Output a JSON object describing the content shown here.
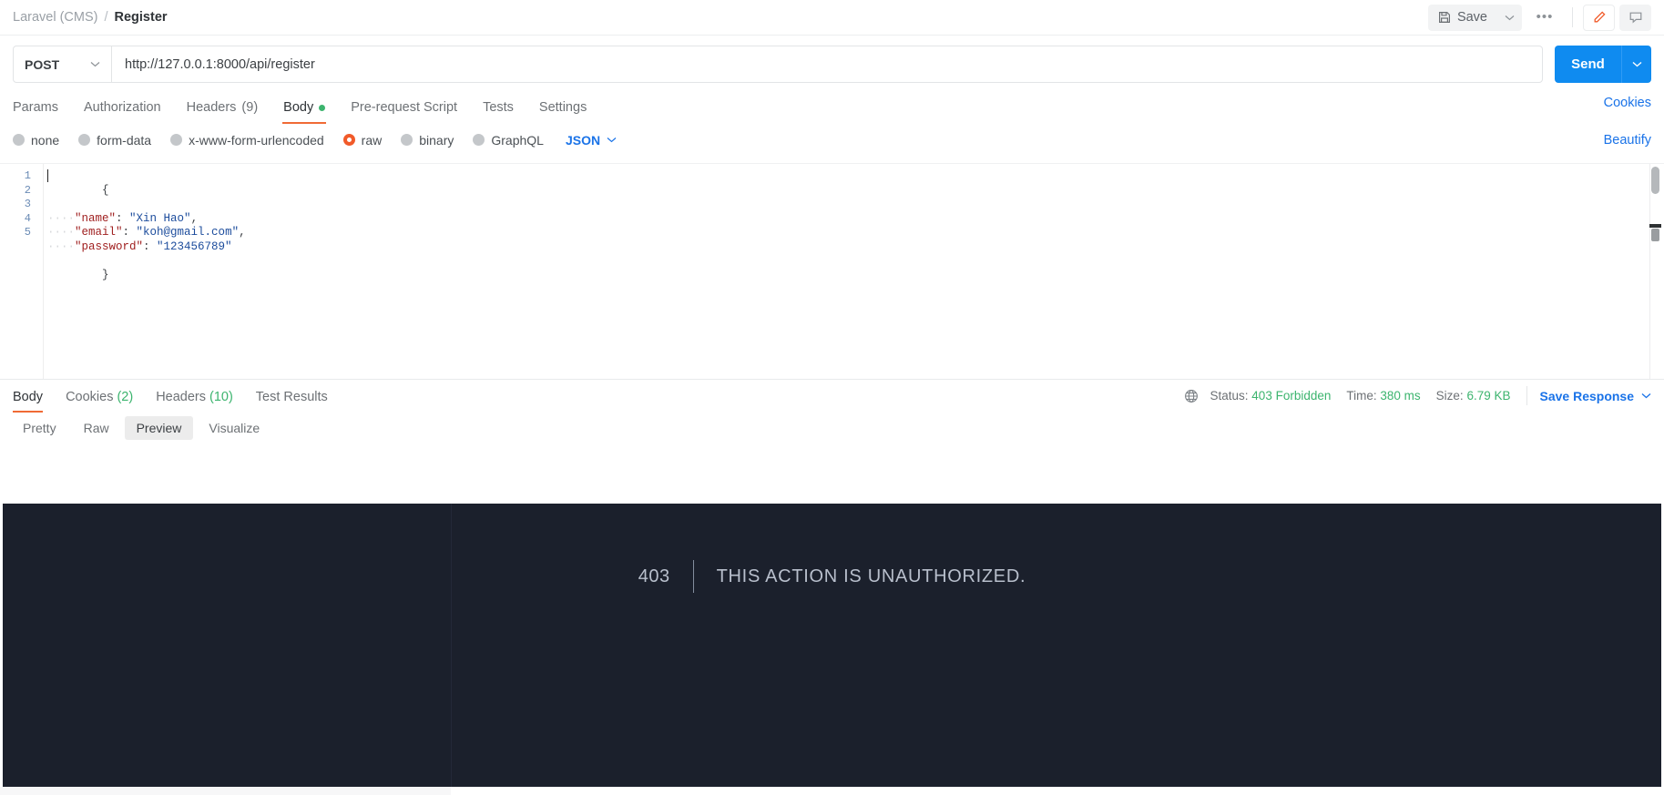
{
  "breadcrumb": {
    "collection": "Laravel (CMS)",
    "separator": "/",
    "request": "Register"
  },
  "toolbar": {
    "save_label": "Save",
    "save_caret_icon": "chevron-down-icon",
    "more_icon": "ellipsis-icon",
    "edit_icon": "pencil-icon",
    "comment_icon": "comment-icon",
    "edit_icon_color": "#f15a29"
  },
  "request": {
    "method": "POST",
    "method_caret_icon": "chevron-down-icon",
    "url": "http://127.0.0.1:8000/api/register",
    "send_label": "Send",
    "send_caret_icon": "chevron-down-icon",
    "send_color": "#0f8bf0"
  },
  "request_tabs": [
    {
      "label": "Params",
      "count": "",
      "active": false,
      "dot": false
    },
    {
      "label": "Authorization",
      "count": "",
      "active": false,
      "dot": false
    },
    {
      "label": "Headers",
      "count": "(9)",
      "active": false,
      "dot": false
    },
    {
      "label": "Body",
      "count": "",
      "active": true,
      "dot": true
    },
    {
      "label": "Pre-request Script",
      "count": "",
      "active": false,
      "dot": false
    },
    {
      "label": "Tests",
      "count": "",
      "active": false,
      "dot": false
    },
    {
      "label": "Settings",
      "count": "",
      "active": false,
      "dot": false
    }
  ],
  "tabs_right_link": "Cookies",
  "body_types": [
    {
      "label": "none",
      "selected": false
    },
    {
      "label": "form-data",
      "selected": false
    },
    {
      "label": "x-www-form-urlencoded",
      "selected": false
    },
    {
      "label": "raw",
      "selected": true
    },
    {
      "label": "binary",
      "selected": false
    },
    {
      "label": "GraphQL",
      "selected": false
    }
  ],
  "body_format": "JSON",
  "body_format_caret_icon": "chevron-down-icon",
  "beautify_link": "Beautify",
  "editor": {
    "line_numbers": [
      "1",
      "2",
      "3",
      "4",
      "5"
    ],
    "lines": [
      {
        "indent": "",
        "text": "{",
        "type": "brace"
      },
      {
        "indent": "····",
        "key": "\"name\"",
        "colon": ": ",
        "value": "\"Xin Hao\"",
        "comma": ","
      },
      {
        "indent": "····",
        "key": "\"email\"",
        "colon": ": ",
        "value": "\"koh@gmail.com\"",
        "comma": ","
      },
      {
        "indent": "····",
        "key": "\"password\"",
        "colon": ": ",
        "value": "\"123456789\"",
        "comma": ""
      },
      {
        "indent": "",
        "text": "}",
        "type": "brace"
      }
    ]
  },
  "response_tabs": [
    {
      "label": "Body",
      "count": "",
      "active": true
    },
    {
      "label": "Cookies",
      "count": "(2)",
      "active": false
    },
    {
      "label": "Headers",
      "count": "(10)",
      "active": false
    },
    {
      "label": "Test Results",
      "count": "",
      "active": false
    }
  ],
  "response_meta": {
    "globe_icon": "globe-icon",
    "status_label": "Status:",
    "status_value": "403 Forbidden",
    "time_label": "Time:",
    "time_value": "380 ms",
    "size_label": "Size:",
    "size_value": "6.79 KB",
    "save_response_label": "Save Response",
    "save_response_caret_icon": "chevron-down-icon",
    "value_color": "#3cb46e"
  },
  "view_modes": [
    {
      "label": "Pretty",
      "active": false
    },
    {
      "label": "Raw",
      "active": false
    },
    {
      "label": "Preview",
      "active": true
    },
    {
      "label": "Visualize",
      "active": false
    }
  ],
  "preview": {
    "error_code": "403",
    "error_message": "THIS ACTION IS UNAUTHORIZED.",
    "background_color": "#1b202c",
    "text_color": "#b8bfcc"
  }
}
